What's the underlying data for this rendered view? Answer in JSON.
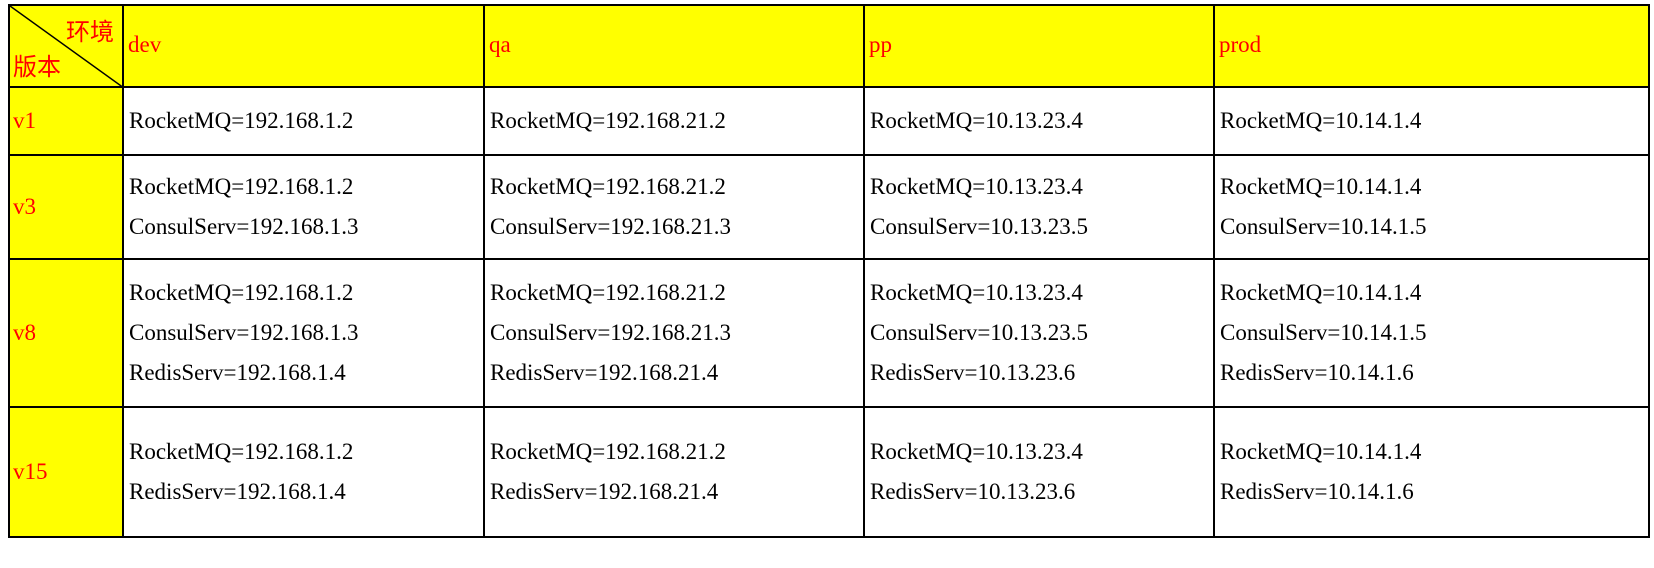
{
  "corner": {
    "top_label": "环境",
    "bottom_label": "版本"
  },
  "environments": [
    "dev",
    "qa",
    "pp",
    "prod"
  ],
  "rows": [
    {
      "version": "v1",
      "cells": [
        [
          "RocketMQ=192.168.1.2"
        ],
        [
          "RocketMQ=192.168.21.2"
        ],
        [
          "RocketMQ=10.13.23.4"
        ],
        [
          "RocketMQ=10.14.1.4"
        ]
      ]
    },
    {
      "version": "v3",
      "cells": [
        [
          "RocketMQ=192.168.1.2",
          "ConsulServ=192.168.1.3"
        ],
        [
          "RocketMQ=192.168.21.2",
          "ConsulServ=192.168.21.3"
        ],
        [
          "RocketMQ=10.13.23.4",
          "ConsulServ=10.13.23.5"
        ],
        [
          "RocketMQ=10.14.1.4",
          "ConsulServ=10.14.1.5"
        ]
      ]
    },
    {
      "version": "v8",
      "cells": [
        [
          "RocketMQ=192.168.1.2",
          "ConsulServ=192.168.1.3",
          "RedisServ=192.168.1.4"
        ],
        [
          "RocketMQ=192.168.21.2",
          "ConsulServ=192.168.21.3",
          "RedisServ=192.168.21.4"
        ],
        [
          "RocketMQ=10.13.23.4",
          "ConsulServ=10.13.23.5",
          "RedisServ=10.13.23.6"
        ],
        [
          "RocketMQ=10.14.1.4",
          "ConsulServ=10.14.1.5",
          "RedisServ=10.14.1.6"
        ]
      ]
    },
    {
      "version": "v15",
      "cells": [
        [
          "RocketMQ=192.168.1.2",
          "RedisServ=192.168.1.4"
        ],
        [
          "RocketMQ=192.168.21.2",
          "RedisServ=192.168.21.4"
        ],
        [
          "RocketMQ=10.13.23.4",
          "RedisServ=10.13.23.6"
        ],
        [
          "RocketMQ=10.14.1.4",
          "RedisServ=10.14.1.6"
        ]
      ]
    }
  ],
  "colors": {
    "header_background": "#ffff00",
    "header_text": "#ff0000",
    "body_text": "#000000",
    "border": "#000000"
  }
}
